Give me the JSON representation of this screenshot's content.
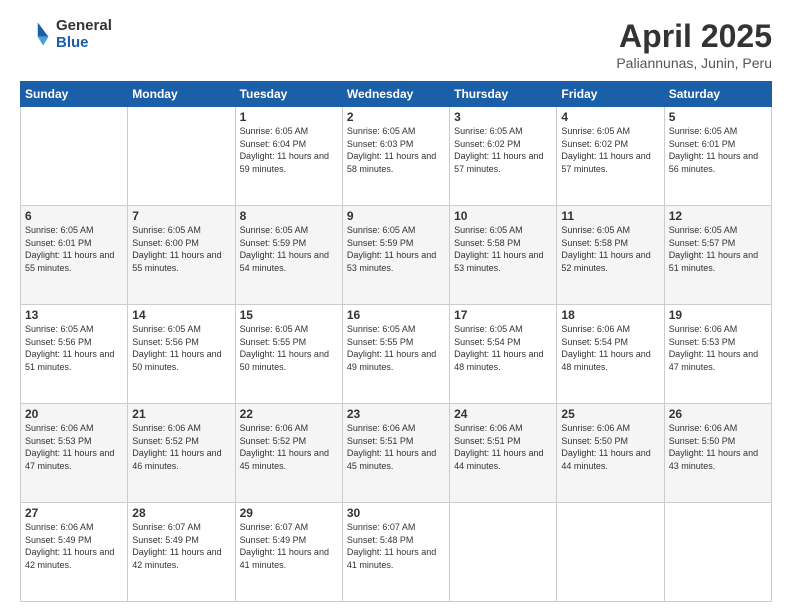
{
  "logo": {
    "general": "General",
    "blue": "Blue"
  },
  "title": "April 2025",
  "subtitle": "Paliannunas, Junin, Peru",
  "weekdays": [
    "Sunday",
    "Monday",
    "Tuesday",
    "Wednesday",
    "Thursday",
    "Friday",
    "Saturday"
  ],
  "weeks": [
    [
      {
        "day": "",
        "info": ""
      },
      {
        "day": "",
        "info": ""
      },
      {
        "day": "1",
        "info": "Sunrise: 6:05 AM\nSunset: 6:04 PM\nDaylight: 11 hours and 59 minutes."
      },
      {
        "day": "2",
        "info": "Sunrise: 6:05 AM\nSunset: 6:03 PM\nDaylight: 11 hours and 58 minutes."
      },
      {
        "day": "3",
        "info": "Sunrise: 6:05 AM\nSunset: 6:02 PM\nDaylight: 11 hours and 57 minutes."
      },
      {
        "day": "4",
        "info": "Sunrise: 6:05 AM\nSunset: 6:02 PM\nDaylight: 11 hours and 57 minutes."
      },
      {
        "day": "5",
        "info": "Sunrise: 6:05 AM\nSunset: 6:01 PM\nDaylight: 11 hours and 56 minutes."
      }
    ],
    [
      {
        "day": "6",
        "info": "Sunrise: 6:05 AM\nSunset: 6:01 PM\nDaylight: 11 hours and 55 minutes."
      },
      {
        "day": "7",
        "info": "Sunrise: 6:05 AM\nSunset: 6:00 PM\nDaylight: 11 hours and 55 minutes."
      },
      {
        "day": "8",
        "info": "Sunrise: 6:05 AM\nSunset: 5:59 PM\nDaylight: 11 hours and 54 minutes."
      },
      {
        "day": "9",
        "info": "Sunrise: 6:05 AM\nSunset: 5:59 PM\nDaylight: 11 hours and 53 minutes."
      },
      {
        "day": "10",
        "info": "Sunrise: 6:05 AM\nSunset: 5:58 PM\nDaylight: 11 hours and 53 minutes."
      },
      {
        "day": "11",
        "info": "Sunrise: 6:05 AM\nSunset: 5:58 PM\nDaylight: 11 hours and 52 minutes."
      },
      {
        "day": "12",
        "info": "Sunrise: 6:05 AM\nSunset: 5:57 PM\nDaylight: 11 hours and 51 minutes."
      }
    ],
    [
      {
        "day": "13",
        "info": "Sunrise: 6:05 AM\nSunset: 5:56 PM\nDaylight: 11 hours and 51 minutes."
      },
      {
        "day": "14",
        "info": "Sunrise: 6:05 AM\nSunset: 5:56 PM\nDaylight: 11 hours and 50 minutes."
      },
      {
        "day": "15",
        "info": "Sunrise: 6:05 AM\nSunset: 5:55 PM\nDaylight: 11 hours and 50 minutes."
      },
      {
        "day": "16",
        "info": "Sunrise: 6:05 AM\nSunset: 5:55 PM\nDaylight: 11 hours and 49 minutes."
      },
      {
        "day": "17",
        "info": "Sunrise: 6:05 AM\nSunset: 5:54 PM\nDaylight: 11 hours and 48 minutes."
      },
      {
        "day": "18",
        "info": "Sunrise: 6:06 AM\nSunset: 5:54 PM\nDaylight: 11 hours and 48 minutes."
      },
      {
        "day": "19",
        "info": "Sunrise: 6:06 AM\nSunset: 5:53 PM\nDaylight: 11 hours and 47 minutes."
      }
    ],
    [
      {
        "day": "20",
        "info": "Sunrise: 6:06 AM\nSunset: 5:53 PM\nDaylight: 11 hours and 47 minutes."
      },
      {
        "day": "21",
        "info": "Sunrise: 6:06 AM\nSunset: 5:52 PM\nDaylight: 11 hours and 46 minutes."
      },
      {
        "day": "22",
        "info": "Sunrise: 6:06 AM\nSunset: 5:52 PM\nDaylight: 11 hours and 45 minutes."
      },
      {
        "day": "23",
        "info": "Sunrise: 6:06 AM\nSunset: 5:51 PM\nDaylight: 11 hours and 45 minutes."
      },
      {
        "day": "24",
        "info": "Sunrise: 6:06 AM\nSunset: 5:51 PM\nDaylight: 11 hours and 44 minutes."
      },
      {
        "day": "25",
        "info": "Sunrise: 6:06 AM\nSunset: 5:50 PM\nDaylight: 11 hours and 44 minutes."
      },
      {
        "day": "26",
        "info": "Sunrise: 6:06 AM\nSunset: 5:50 PM\nDaylight: 11 hours and 43 minutes."
      }
    ],
    [
      {
        "day": "27",
        "info": "Sunrise: 6:06 AM\nSunset: 5:49 PM\nDaylight: 11 hours and 42 minutes."
      },
      {
        "day": "28",
        "info": "Sunrise: 6:07 AM\nSunset: 5:49 PM\nDaylight: 11 hours and 42 minutes."
      },
      {
        "day": "29",
        "info": "Sunrise: 6:07 AM\nSunset: 5:49 PM\nDaylight: 11 hours and 41 minutes."
      },
      {
        "day": "30",
        "info": "Sunrise: 6:07 AM\nSunset: 5:48 PM\nDaylight: 11 hours and 41 minutes."
      },
      {
        "day": "",
        "info": ""
      },
      {
        "day": "",
        "info": ""
      },
      {
        "day": "",
        "info": ""
      }
    ]
  ]
}
